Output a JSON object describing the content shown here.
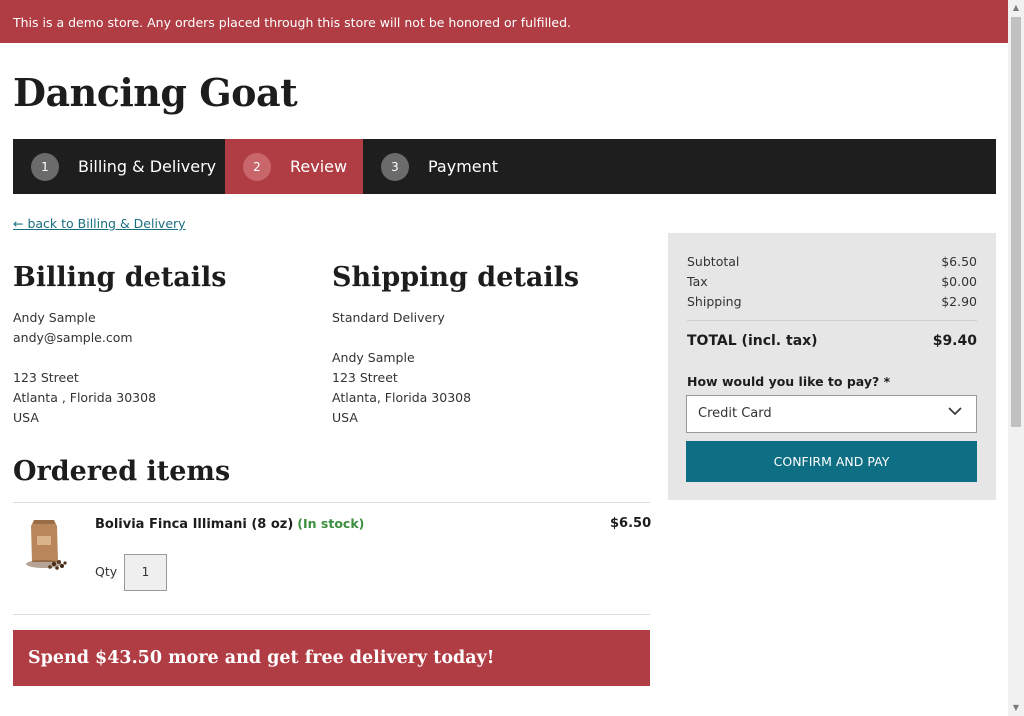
{
  "banner": {
    "text": "This is a demo store. Any orders placed through this store will not be honored or fulfilled."
  },
  "brand": {
    "title": "Dancing Goat"
  },
  "steps": [
    {
      "num": "1",
      "label": "Billing & Delivery"
    },
    {
      "num": "2",
      "label": "Review"
    },
    {
      "num": "3",
      "label": "Payment"
    }
  ],
  "back_link": "← back to Billing & Delivery",
  "billing": {
    "title": "Billing details",
    "name": "Andy Sample",
    "email": "andy@sample.com",
    "street": "123 Street",
    "city": "Atlanta , Florida 30308",
    "country": "USA"
  },
  "shipping": {
    "title": "Shipping details",
    "method": "Standard Delivery",
    "name": "Andy Sample",
    "street": "123 Street",
    "city": "Atlanta, Florida 30308",
    "country": "USA"
  },
  "ordered": {
    "title": "Ordered items",
    "item": {
      "name": "Bolivia Finca Illimani (8 oz)",
      "stock": "(In stock)",
      "price": "$6.50",
      "qty_label": "Qty",
      "qty": "1"
    }
  },
  "promo": "Spend $43.50 more and get free delivery today!",
  "summary": {
    "subtotal_label": "Subtotal",
    "subtotal": "$6.50",
    "tax_label": "Tax",
    "tax": "$0.00",
    "shipping_label": "Shipping",
    "shipping": "$2.90",
    "total_label": "TOTAL (incl. tax)",
    "total": "$9.40",
    "pay_label": "How would you like to pay? *",
    "pay_selected": "Credit Card",
    "confirm_label": "CONFIRM AND PAY"
  },
  "colors": {
    "accent": "#b13d44",
    "button": "#0e6e84",
    "nav": "#1e1e1e",
    "in_stock": "#3b8f3e"
  }
}
